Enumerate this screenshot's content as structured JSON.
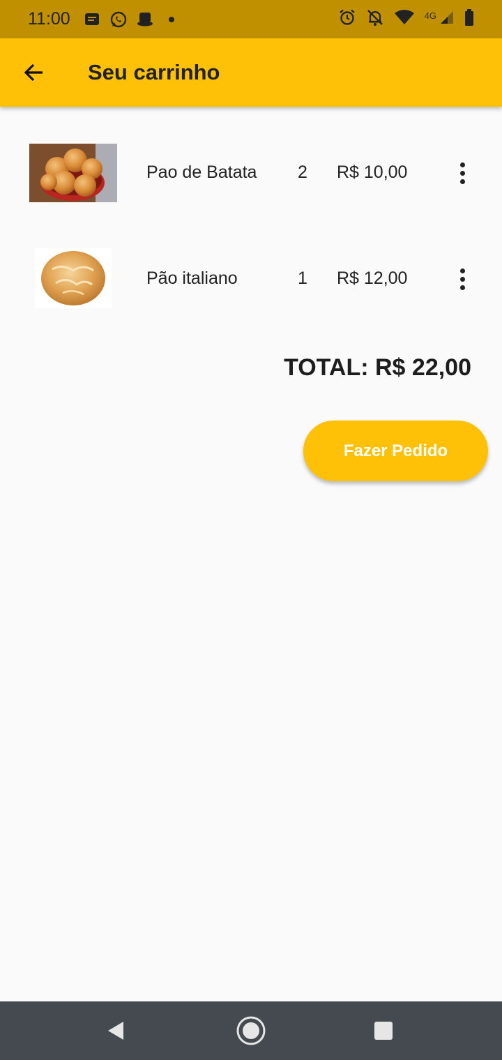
{
  "status_bar": {
    "time": "11:00",
    "left_icons": [
      "message-icon",
      "whatsapp-icon",
      "hat-icon",
      "dot-icon"
    ],
    "right_icons": [
      "alarm-icon",
      "notifications-off-icon",
      "wifi-icon",
      "signal-icon",
      "battery-icon"
    ],
    "network_label": "4G"
  },
  "app_bar": {
    "title": "Seu carrinho",
    "back_icon": "arrow-back-icon"
  },
  "cart": {
    "items": [
      {
        "name": "Pao de Batata",
        "quantity": "2",
        "price": "R$ 10,00",
        "image": "potato-bread-rolls"
      },
      {
        "name": "Pão italiano",
        "quantity": "1",
        "price": "R$ 12,00",
        "image": "italian-bread-loaf"
      }
    ],
    "total_label": "TOTAL: R$ 22,00"
  },
  "actions": {
    "order_button": "Fazer Pedido"
  },
  "nav_bar": {
    "buttons": [
      "back-triangle-icon",
      "home-circle-icon",
      "recents-square-icon"
    ]
  },
  "colors": {
    "status_bar": "#c09000",
    "app_bar": "#ffc107",
    "button": "#ffc107",
    "background": "#fafafa",
    "nav_bar": "#444a50"
  }
}
